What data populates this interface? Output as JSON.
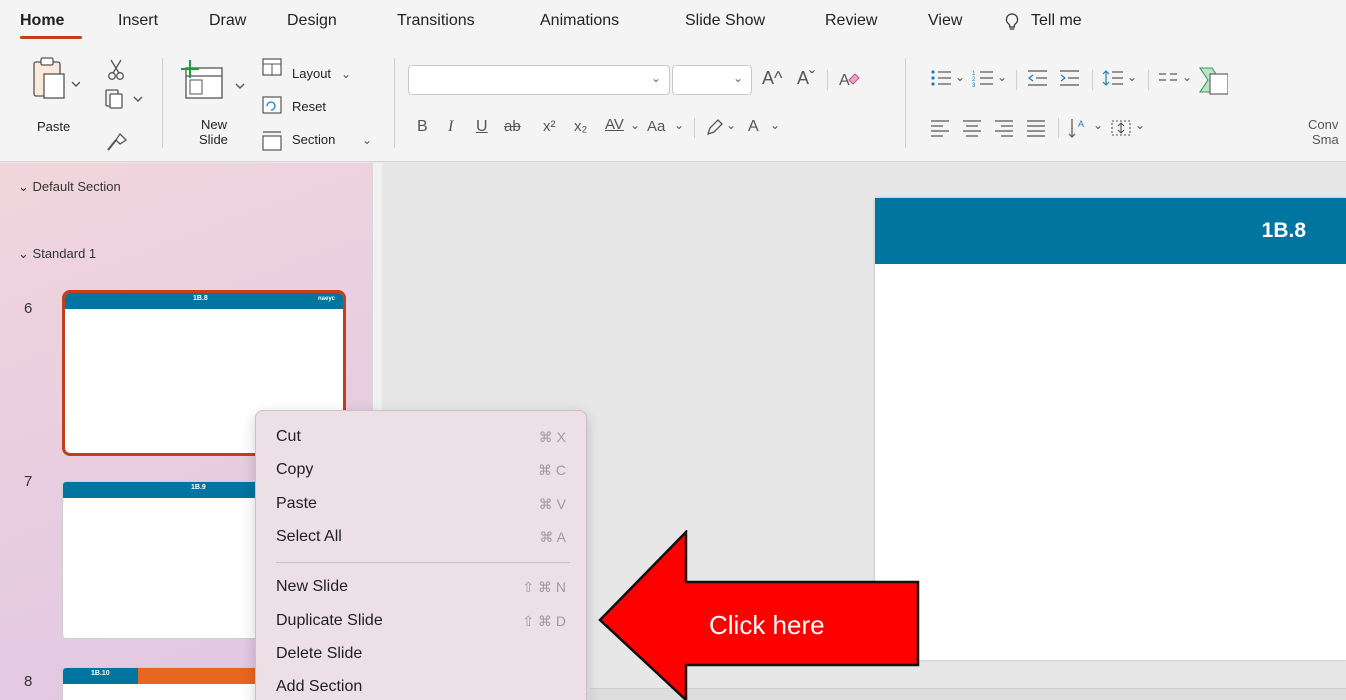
{
  "tabs": [
    {
      "label": "Home"
    },
    {
      "label": "Insert"
    },
    {
      "label": "Draw"
    },
    {
      "label": "Design"
    },
    {
      "label": "Transitions"
    },
    {
      "label": "Animations"
    },
    {
      "label": "Slide Show"
    },
    {
      "label": "Review"
    },
    {
      "label": "View"
    },
    {
      "label": "Tell me"
    }
  ],
  "ribbon": {
    "paste_label": "Paste",
    "new_slide_label_1": "New",
    "new_slide_label_2": "Slide",
    "layout_label": "Layout",
    "reset_label": "Reset",
    "section_label": "Section",
    "convert_label_1": "Conv",
    "convert_label_2": "Sma",
    "format_glyphs": {
      "bold": "B",
      "italic": "I",
      "underline": "U",
      "strike": "ab",
      "superscript": "x²",
      "subscript": "x₂",
      "spacing": "AV",
      "case": "Aa",
      "font_color": "A",
      "grow": "A^",
      "shrink": "Aˇ"
    }
  },
  "sections": {
    "default": "Default Section",
    "standard": "Standard 1"
  },
  "slides": [
    {
      "number": "6",
      "title": "1B.8",
      "logo": "naeyc"
    },
    {
      "number": "7",
      "title": "1B.9"
    },
    {
      "number": "8",
      "title": "1B.10"
    }
  ],
  "main_slide": {
    "title": "1B.8"
  },
  "context_menu": {
    "items": [
      {
        "label": "Cut",
        "shortcut": "⌘ X"
      },
      {
        "label": "Copy",
        "shortcut": "⌘ C"
      },
      {
        "label": "Paste",
        "shortcut": "⌘ V"
      },
      {
        "label": "Select All",
        "shortcut": "⌘ A"
      },
      {
        "label": "New Slide",
        "shortcut": "⇧ ⌘ N"
      },
      {
        "label": "Duplicate Slide",
        "shortcut": "⇧ ⌘ D"
      },
      {
        "label": "Delete Slide",
        "shortcut": ""
      },
      {
        "label": "Add Section",
        "shortcut": ""
      }
    ]
  },
  "callout": {
    "text": "Click here"
  },
  "colors": {
    "accent": "#c43e1c",
    "slide_header": "#00759f",
    "callout_red": "#ff0000"
  }
}
